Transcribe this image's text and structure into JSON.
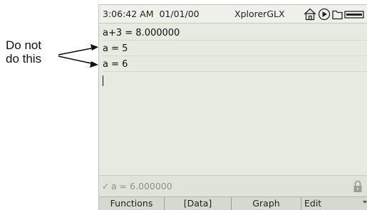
{
  "annotation": {
    "lines": [
      "Do not",
      "do this"
    ],
    "arrow_color": "#111111"
  },
  "status_bar": {
    "time": "3:06:42 AM",
    "date": "01/01/00",
    "title": "XplorerGLX",
    "icons": [
      "home-icon",
      "play-icon",
      "folder-icon",
      "battery-icon"
    ]
  },
  "calculator": {
    "lines": [
      "a+3 = 8.000000",
      "a = 5",
      "a = 6"
    ],
    "input_value": ""
  },
  "result": {
    "check": "✓",
    "text": "a = 6.000000",
    "lock_icon": "lock-icon"
  },
  "menu": {
    "items": [
      "Functions",
      "[Data]",
      "Graph",
      "Edit"
    ]
  },
  "colors": {
    "screen_background": "#e6ebe0",
    "menu_background": "#d5dace",
    "result_text": "#8d9288"
  }
}
